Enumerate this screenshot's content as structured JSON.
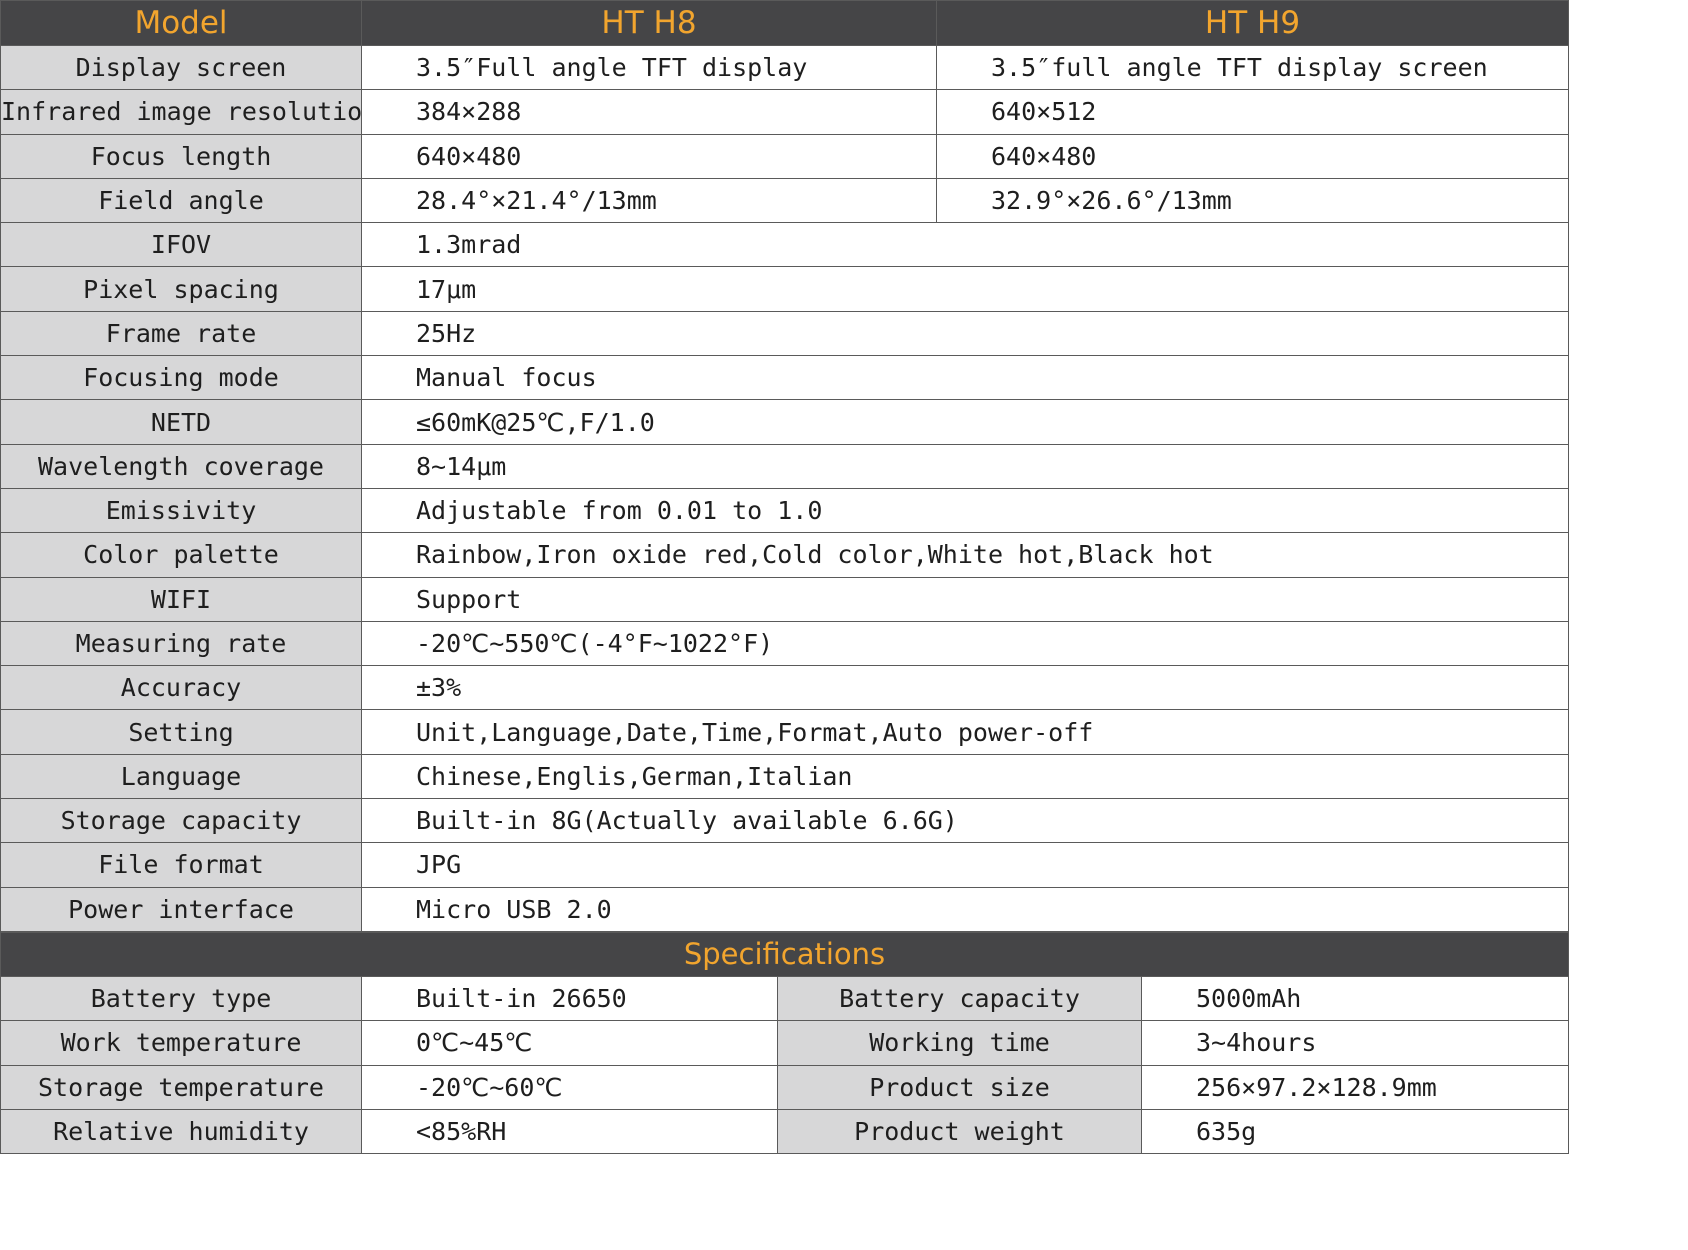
{
  "header": {
    "model": "Model",
    "h8": "HT H8",
    "h9": "HT H9"
  },
  "split_rows": [
    {
      "label": "Display screen",
      "h8": "3.5″Full angle TFT display",
      "h9": "3.5″full angle TFT display screen"
    },
    {
      "label": "Infrared image resolution",
      "h8": "384×288",
      "h9": "640×512"
    },
    {
      "label": "Focus length",
      "h8": "640×480",
      "h9": "640×480"
    },
    {
      "label": "Field angle",
      "h8": "28.4°×21.4°/13mm",
      "h9": "32.9°×26.6°/13mm"
    }
  ],
  "shared_rows": [
    {
      "label": "IFOV",
      "value": "1.3mrad"
    },
    {
      "label": "Pixel spacing",
      "value": "17μm"
    },
    {
      "label": "Frame rate",
      "value": "25Hz"
    },
    {
      "label": "Focusing mode",
      "value": "Manual focus"
    },
    {
      "label": "NETD",
      "value": "≤60mK@25℃,F/1.0"
    },
    {
      "label": "Wavelength coverage",
      "value": "8~14μm"
    },
    {
      "label": "Emissivity",
      "value": "Adjustable from 0.01 to 1.0"
    },
    {
      "label": "Color palette",
      "value": "Rainbow,Iron oxide red,Cold color,White hot,Black hot"
    },
    {
      "label": "WIFI",
      "value": "Support"
    },
    {
      "label": "Measuring rate",
      "value": "-20℃~550℃(-4°F~1022°F)"
    },
    {
      "label": "Accuracy",
      "value": "±3%"
    },
    {
      "label": "Setting",
      "value": "Unit,Language,Date,Time,Format,Auto power-off"
    },
    {
      "label": "Language",
      "value": "Chinese,Englis,German,Italian"
    },
    {
      "label": "Storage capacity",
      "value": "Built-in 8G(Actually available 6.6G)"
    },
    {
      "label": "File format",
      "value": "JPG"
    },
    {
      "label": "Power interface",
      "value": "Micro USB 2.0"
    }
  ],
  "specs": {
    "title": "Specifications",
    "rows": [
      {
        "label1": "Battery type",
        "value1": "Built-in 26650",
        "label2": "Battery capacity",
        "value2": "5000mAh"
      },
      {
        "label1": "Work temperature",
        "value1": "0℃~45℃",
        "label2": "Working time",
        "value2": "3~4hours"
      },
      {
        "label1": "Storage temperature",
        "value1": "-20℃~60℃",
        "label2": "Product size",
        "value2": "256×97.2×128.9mm"
      },
      {
        "label1": "Relative humidity",
        "value1": "<85%RH",
        "label2": "Product weight",
        "value2": "635g"
      }
    ]
  }
}
